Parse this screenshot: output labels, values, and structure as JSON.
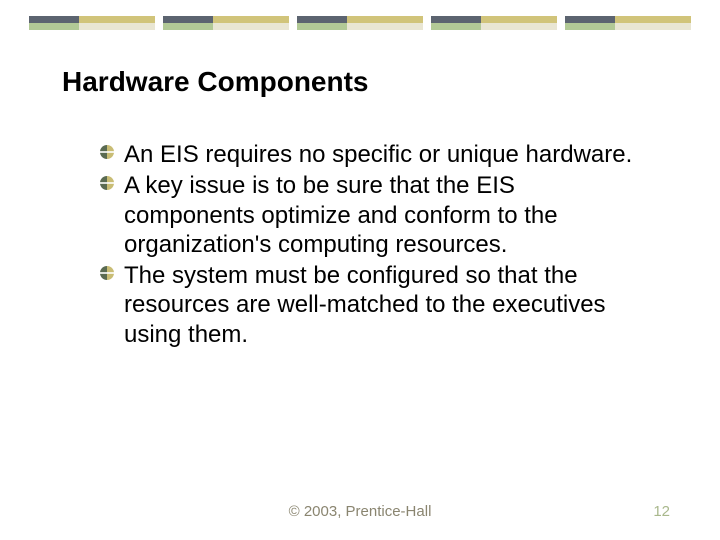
{
  "title": "Hardware Components",
  "bullets": [
    "An EIS requires no specific or unique hardware.",
    "A key issue is to be sure that the EIS components optimize and conform to the organization's computing resources.",
    "The system must be configured so that the resources are well-matched to the executives using them."
  ],
  "footer": {
    "copyright": "© 2003, Prentice-Hall",
    "page": "12"
  }
}
